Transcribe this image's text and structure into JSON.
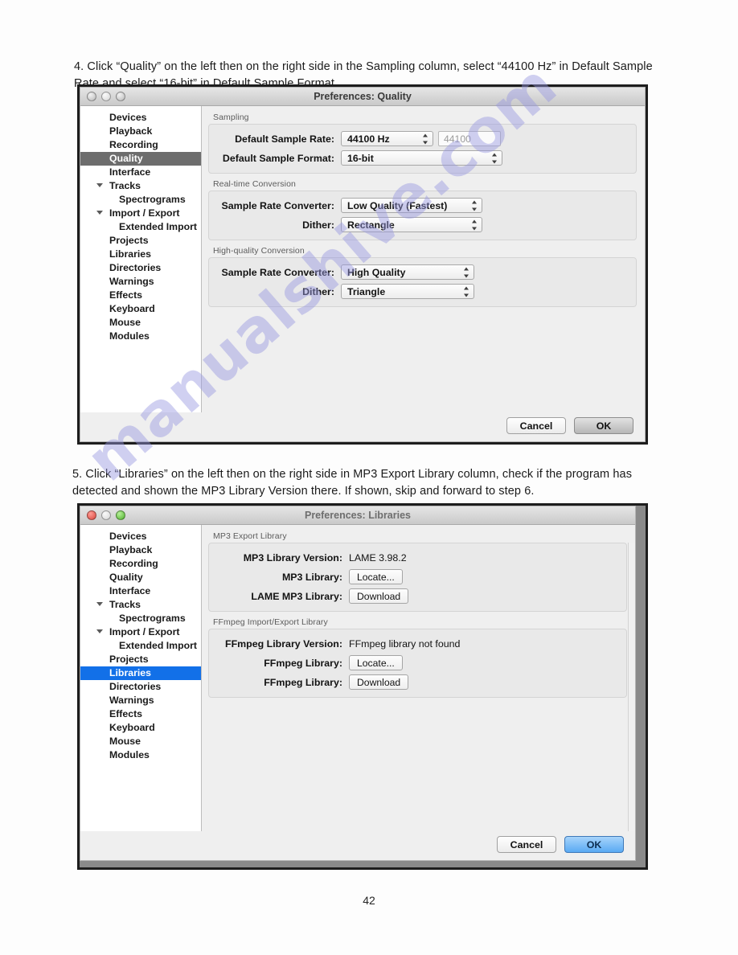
{
  "document": {
    "page_number": "42",
    "watermark": "manualshive.com"
  },
  "steps": {
    "step4": "4.     Click “Quality” on the left then on the right side in the Sampling column, select “44100 Hz” in Default Sample Rate and select “16-bit” in Default Sample Format.",
    "step5": "5. Click “Libraries” on the left then on the right side in MP3 Export Library column, check if the program has detected and shown the MP3 Library Version there. If shown, skip and forward to step 6."
  },
  "quality_window": {
    "title": "Preferences: Quality",
    "traffic_lights": [
      "close-gray",
      "minimize-gray",
      "zoom-gray"
    ],
    "sidebar": [
      {
        "label": "Devices",
        "level": 0,
        "triangle": false,
        "selected": false
      },
      {
        "label": "Playback",
        "level": 0,
        "triangle": false,
        "selected": false
      },
      {
        "label": "Recording",
        "level": 0,
        "triangle": false,
        "selected": false
      },
      {
        "label": "Quality",
        "level": 0,
        "triangle": false,
        "selected": true
      },
      {
        "label": "Interface",
        "level": 0,
        "triangle": false,
        "selected": false
      },
      {
        "label": "Tracks",
        "level": 0,
        "triangle": true,
        "selected": false
      },
      {
        "label": "Spectrograms",
        "level": 1,
        "triangle": false,
        "selected": false
      },
      {
        "label": "Import / Export",
        "level": 0,
        "triangle": true,
        "selected": false
      },
      {
        "label": "Extended Import",
        "level": 1,
        "triangle": false,
        "selected": false
      },
      {
        "label": "Projects",
        "level": 0,
        "triangle": false,
        "selected": false
      },
      {
        "label": "Libraries",
        "level": 0,
        "triangle": false,
        "selected": false
      },
      {
        "label": "Directories",
        "level": 0,
        "triangle": false,
        "selected": false
      },
      {
        "label": "Warnings",
        "level": 0,
        "triangle": false,
        "selected": false
      },
      {
        "label": "Effects",
        "level": 0,
        "triangle": false,
        "selected": false
      },
      {
        "label": "Keyboard",
        "level": 0,
        "triangle": false,
        "selected": false
      },
      {
        "label": "Mouse",
        "level": 0,
        "triangle": false,
        "selected": false
      },
      {
        "label": "Modules",
        "level": 0,
        "triangle": false,
        "selected": false
      }
    ],
    "sampling": {
      "group_label": "Sampling",
      "sample_rate_label": "Default Sample Rate:",
      "sample_rate_value": "44100 Hz",
      "sample_rate_field": "44100",
      "sample_format_label": "Default Sample Format:",
      "sample_format_value": "16-bit"
    },
    "realtime": {
      "group_label": "Real-time Conversion",
      "converter_label": "Sample Rate Converter:",
      "converter_value": "Low Quality (Fastest)",
      "dither_label": "Dither:",
      "dither_value": "Rectangle"
    },
    "highquality": {
      "group_label": "High-quality Conversion",
      "converter_label": "Sample Rate Converter:",
      "converter_value": "High Quality",
      "dither_label": "Dither:",
      "dither_value": "Triangle"
    },
    "footer": {
      "cancel": "Cancel",
      "ok": "OK",
      "ok_style": "gray"
    }
  },
  "libraries_window": {
    "title": "Preferences: Libraries",
    "traffic_lights": [
      "close-red",
      "minimize-gray",
      "zoom-green"
    ],
    "colors": {
      "close": "#d9473f",
      "minimize": "#d6d6d6",
      "zoom": "#4fb12c",
      "selection": "#1270e8"
    },
    "sidebar": [
      {
        "label": "Devices",
        "level": 0,
        "triangle": false,
        "selected": false
      },
      {
        "label": "Playback",
        "level": 0,
        "triangle": false,
        "selected": false
      },
      {
        "label": "Recording",
        "level": 0,
        "triangle": false,
        "selected": false
      },
      {
        "label": "Quality",
        "level": 0,
        "triangle": false,
        "selected": false
      },
      {
        "label": "Interface",
        "level": 0,
        "triangle": false,
        "selected": false
      },
      {
        "label": "Tracks",
        "level": 0,
        "triangle": true,
        "selected": false
      },
      {
        "label": "Spectrograms",
        "level": 1,
        "triangle": false,
        "selected": false
      },
      {
        "label": "Import / Export",
        "level": 0,
        "triangle": true,
        "selected": false
      },
      {
        "label": "Extended Import",
        "level": 1,
        "triangle": false,
        "selected": false
      },
      {
        "label": "Projects",
        "level": 0,
        "triangle": false,
        "selected": false
      },
      {
        "label": "Libraries",
        "level": 0,
        "triangle": false,
        "selected": true
      },
      {
        "label": "Directories",
        "level": 0,
        "triangle": false,
        "selected": false
      },
      {
        "label": "Warnings",
        "level": 0,
        "triangle": false,
        "selected": false
      },
      {
        "label": "Effects",
        "level": 0,
        "triangle": false,
        "selected": false
      },
      {
        "label": "Keyboard",
        "level": 0,
        "triangle": false,
        "selected": false
      },
      {
        "label": "Mouse",
        "level": 0,
        "triangle": false,
        "selected": false
      },
      {
        "label": "Modules",
        "level": 0,
        "triangle": false,
        "selected": false
      }
    ],
    "mp3": {
      "group_label": "MP3 Export Library",
      "version_label": "MP3 Library Version:",
      "version_value": "LAME 3.98.2",
      "locate_label": "MP3 Library:",
      "locate_button": "Locate...",
      "download_label": "LAME MP3 Library:",
      "download_button": "Download"
    },
    "ffmpeg": {
      "group_label": "FFmpeg Import/Export Library",
      "version_label": "FFmpeg Library Version:",
      "version_value": "FFmpeg library not found",
      "locate_label": "FFmpeg Library:",
      "locate_button": "Locate...",
      "download_label": "FFmpeg Library:",
      "download_button": "Download"
    },
    "footer": {
      "cancel": "Cancel",
      "ok": "OK",
      "ok_style": "blue"
    }
  }
}
